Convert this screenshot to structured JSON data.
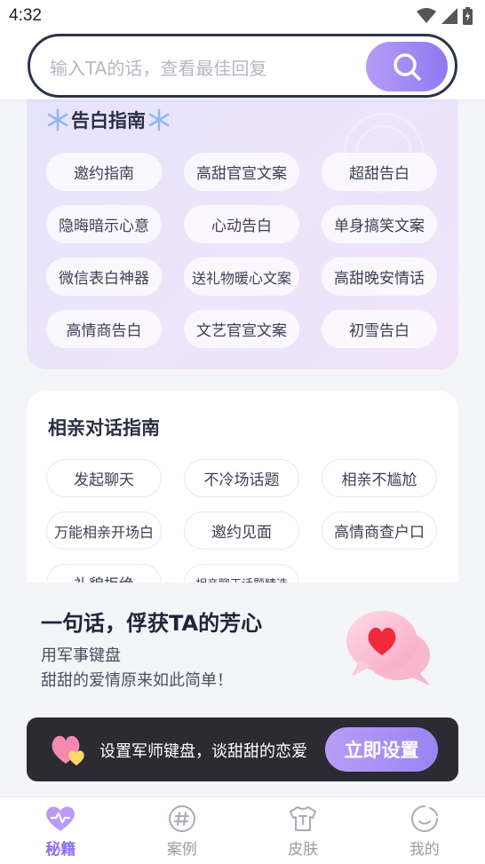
{
  "status_bar": {
    "time": "4:32"
  },
  "search": {
    "placeholder": "输入TA的话，查看最佳回复"
  },
  "confession_guide": {
    "title": "告白指南",
    "items": [
      "邀约指南",
      "高甜官宣文案",
      "超甜告白",
      "隐晦暗示心意",
      "心动告白",
      "单身搞笑文案",
      "微信表白神器",
      "送礼物暖心文案",
      "高甜晚安情话",
      "高情商告白",
      "文艺官宣文案",
      "初雪告白"
    ]
  },
  "blind_date_guide": {
    "title": "相亲对话指南",
    "items": [
      "发起聊天",
      "不冷场话题",
      "相亲不尴尬",
      "万能相亲开场白",
      "邀约见面",
      "高情商查户口",
      "礼貌拒绝",
      "相亲聊天话题精选"
    ]
  },
  "promo": {
    "title": "一句话，俘获TA的芳心",
    "line1": "用军事键盘",
    "line2": "甜甜的爱情原来如此简单！"
  },
  "banner": {
    "text": "设置军师键盘，谈甜甜的恋爱",
    "button": "立即设置"
  },
  "tabs": [
    {
      "label": "秘籍",
      "icon": "heart-pulse-icon",
      "active": true
    },
    {
      "label": "案例",
      "icon": "hash-icon",
      "active": false
    },
    {
      "label": "皮肤",
      "icon": "tshirt-icon",
      "active": false
    },
    {
      "label": "我的",
      "icon": "profile-icon",
      "active": false
    }
  ],
  "colors": {
    "accent": "#8f6ff3",
    "search_border": "#2e3250",
    "banner_bg": "#2c2a33"
  }
}
